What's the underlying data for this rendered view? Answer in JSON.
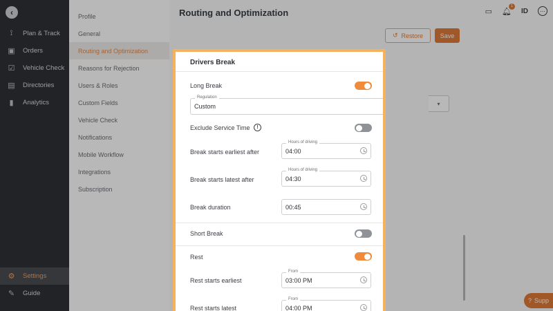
{
  "nav": {
    "items": [
      {
        "label": "Plan & Track",
        "icon": "route-icon"
      },
      {
        "label": "Orders",
        "icon": "orders-icon"
      },
      {
        "label": "Vehicle Check",
        "icon": "vehicle-check-icon"
      },
      {
        "label": "Directories",
        "icon": "directory-icon"
      },
      {
        "label": "Analytics",
        "icon": "analytics-icon"
      }
    ],
    "settings_label": "Settings",
    "guide_label": "Guide"
  },
  "submenu": {
    "items": [
      "Profile",
      "General",
      "Routing and Optimization",
      "Reasons for Rejection",
      "Users & Roles",
      "Custom Fields",
      "Vehicle Check",
      "Notifications",
      "Mobile Workflow",
      "Integrations",
      "Subscription"
    ],
    "active": "Routing and Optimization"
  },
  "header": {
    "title": "Routing and Optimization",
    "notification_count": "1",
    "user_initials": "ID",
    "restore_label": "Restore",
    "save_label": "Save",
    "support_label": "Supp"
  },
  "card": {
    "title": "Drivers Break",
    "long_break": {
      "label": "Long Break",
      "enabled": true
    },
    "regulation": {
      "legend": "Regulation",
      "value": "Custom"
    },
    "exclude_service_time": {
      "label": "Exclude Service Time",
      "enabled": false
    },
    "break_earliest": {
      "label": "Break starts earliest after",
      "legend": "Hours of driving",
      "value": "04:00"
    },
    "break_latest": {
      "label": "Break starts latest after",
      "legend": "Hours of driving",
      "value": "04:30"
    },
    "break_duration": {
      "label": "Break duration",
      "value": "00:45"
    },
    "short_break": {
      "label": "Short Break",
      "enabled": false
    },
    "rest": {
      "label": "Rest",
      "enabled": true
    },
    "rest_earliest": {
      "label": "Rest starts earliest",
      "legend": "From",
      "value": "03:00 PM"
    },
    "rest_latest": {
      "label": "Rest starts latest",
      "legend": "From",
      "value": "04:00 PM"
    }
  },
  "colors": {
    "accent": "#e07b3a",
    "highlight_border": "#f5b15e",
    "nav_bg": "#2f3136"
  }
}
